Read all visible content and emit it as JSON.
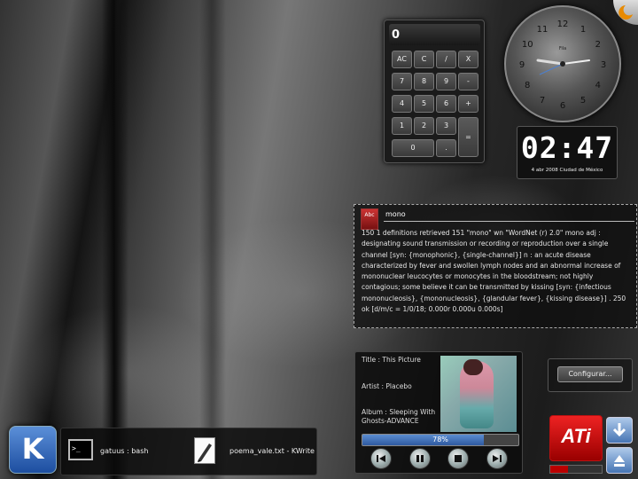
{
  "calculator": {
    "display": "0",
    "buttons": [
      "AC",
      "C",
      "/",
      "X",
      "7",
      "8",
      "9",
      "-",
      "4",
      "5",
      "6",
      "+",
      "1",
      "2",
      "3",
      "=",
      "0",
      "."
    ]
  },
  "clock": {
    "numerals": [
      "12",
      "1",
      "2",
      "3",
      "4",
      "5",
      "6",
      "7",
      "8",
      "9",
      "10",
      "11"
    ],
    "brand": "Fila",
    "digital_time": "02:47",
    "digital_date": "4 abr 2008 Ciudad de México"
  },
  "dictionary": {
    "icon_label": "Abc",
    "query": "mono",
    "result": "150 1 definitions retrieved 151 \"mono\" wn \"WordNet (r) 2.0\" mono adj : designating sound transmission or recording or reproduction over a single channel [syn: {monophonic}, {single-channel}] n : an acute disease characterized by fever and swollen lymph nodes and an abnormal increase of mononuclear leucocytes or monocytes in the bloodstream; not highly contagious; some believe it can be transmitted by kissing [syn: {infectious mononucleosis}, {mononucleosis}, {glandular fever}, {kissing disease}] . 250 ok [d/m/c = 1/0/18; 0.000r 0.000u 0.000s]"
  },
  "player": {
    "title": "Title : This Picture",
    "artist": "Artist : Placebo",
    "album": "Album : Sleeping With Ghosts-ADVANCE",
    "progress_label": "78%",
    "progress": 0.78
  },
  "config": {
    "label": "Configurar..."
  },
  "ati": {
    "label": "ATi",
    "usage": 0.35
  },
  "taskbar": {
    "start_label": "K",
    "terminal_icon_text": ">_",
    "tasks": [
      {
        "label": "gatuus : bash"
      },
      {
        "label": "poema_vale.txt - KWrite"
      }
    ]
  },
  "colors": {
    "accent": "#2f5aa0",
    "ati_red": "#dd2222"
  }
}
